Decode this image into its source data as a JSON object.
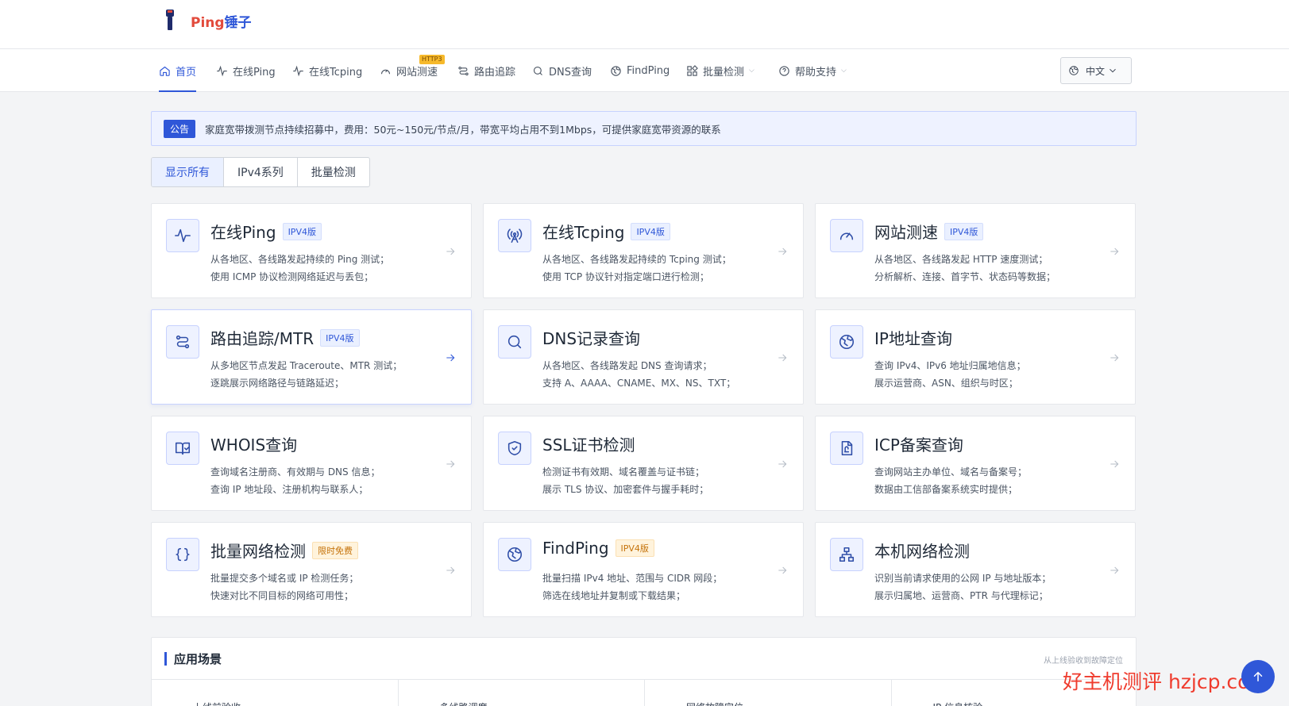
{
  "brand": {
    "name_part1": "Ping",
    "name_part2": "锤子"
  },
  "nav": {
    "items": [
      {
        "label": "首页",
        "icon": "home-icon"
      },
      {
        "label": "在线Ping",
        "icon": "pulse-icon"
      },
      {
        "label": "在线Tcping",
        "icon": "pulse-icon"
      },
      {
        "label": "网站测速",
        "icon": "gauge-icon",
        "badge": "HTTP3"
      },
      {
        "label": "路由追踪",
        "icon": "route-icon"
      },
      {
        "label": "DNS查询",
        "icon": "search-icon"
      },
      {
        "label": "FindPing",
        "icon": "globe-icon"
      },
      {
        "label": "批量检测",
        "icon": "grid-icon"
      },
      {
        "label": "帮助支持",
        "icon": "help-icon"
      }
    ],
    "language": "中文"
  },
  "notice": {
    "tag": "公告",
    "text": "家庭宽带拨测节点持续招募中，费用：50元~150元/节点/月，带宽平均占用不到1Mbps，可提供家庭宽带资源的联系"
  },
  "filters": [
    "显示所有",
    "IPv4系列",
    "批量检测"
  ],
  "cards": [
    {
      "title": "在线Ping",
      "badge": "IPV4版",
      "icon": "pulse-icon",
      "line1": "从各地区、各线路发起持续的 Ping 测试；",
      "line2": "使用 ICMP 协议检测网络延迟与丢包；"
    },
    {
      "title": "在线Tcping",
      "badge": "IPV4版",
      "icon": "antenna-icon",
      "line1": "从各地区、各线路发起持续的 Tcping 测试；",
      "line2": "使用 TCP 协议针对指定端口进行检测；"
    },
    {
      "title": "网站测速",
      "badge": "IPV4版",
      "icon": "gauge-icon",
      "line1": "从各地区、各线路发起 HTTP 速度测试；",
      "line2": "分析解析、连接、首字节、状态码等数据；"
    },
    {
      "title": "路由追踪/MTR",
      "badge": "IPV4版",
      "icon": "route-icon",
      "line1": "从多地区节点发起 Traceroute、MTR 测试；",
      "line2": "逐跳展示网络路径与链路延迟；"
    },
    {
      "title": "DNS记录查询",
      "badge": "",
      "icon": "search-icon",
      "line1": "从各地区、各线路发起 DNS 查询请求；",
      "line2": "支持 A、AAAA、CNAME、MX、NS、TXT；"
    },
    {
      "title": "IP地址查询",
      "badge": "",
      "icon": "globe-icon",
      "line1": "查询 IPv4、IPv6 地址归属地信息；",
      "line2": "展示运营商、ASN、组织与时区；"
    },
    {
      "title": "WHOIS查询",
      "badge": "",
      "icon": "book-icon",
      "line1": "查询域名注册商、有效期与 DNS 信息；",
      "line2": "查询 IP 地址段、注册机构与联系人；"
    },
    {
      "title": "SSL证书检测",
      "badge": "",
      "icon": "shield-icon",
      "line1": "检测证书有效期、域名覆盖与证书链；",
      "line2": "展示 TLS 协议、加密套件与握手耗时；"
    },
    {
      "title": "ICP备案查询",
      "badge": "",
      "icon": "document-icon",
      "line1": "查询网站主办单位、域名与备案号；",
      "line2": "数据由工信部备案系统实时提供；"
    },
    {
      "title": "批量网络检测",
      "badge": "限时免费",
      "icon": "braces-icon",
      "line1": "批量提交多个域名或 IP 检测任务；",
      "line2": "快速对比不同目标的网络可用性；"
    },
    {
      "title": "FindPing",
      "badge": "IPV4版",
      "icon": "globe-icon",
      "line1": "批量扫描 IPv4 地址、范围与 CIDR 网段；",
      "line2": "筛选在线地址并复制或下载结果；"
    },
    {
      "title": "本机网络检测",
      "badge": "",
      "icon": "network-icon",
      "line1": "识别当前请求使用的公网 IP 与地址版本；",
      "line2": "展示归属地、运营商、PTR 与代理标记；"
    }
  ],
  "scenario": {
    "title": "应用场景",
    "hint": "从上线验收到故障定位",
    "columns": [
      "上线前验收",
      "多线路调度",
      "网络故障定位",
      "IP 信息核验"
    ]
  },
  "watermark": "好主机测评 hzjcp.com"
}
